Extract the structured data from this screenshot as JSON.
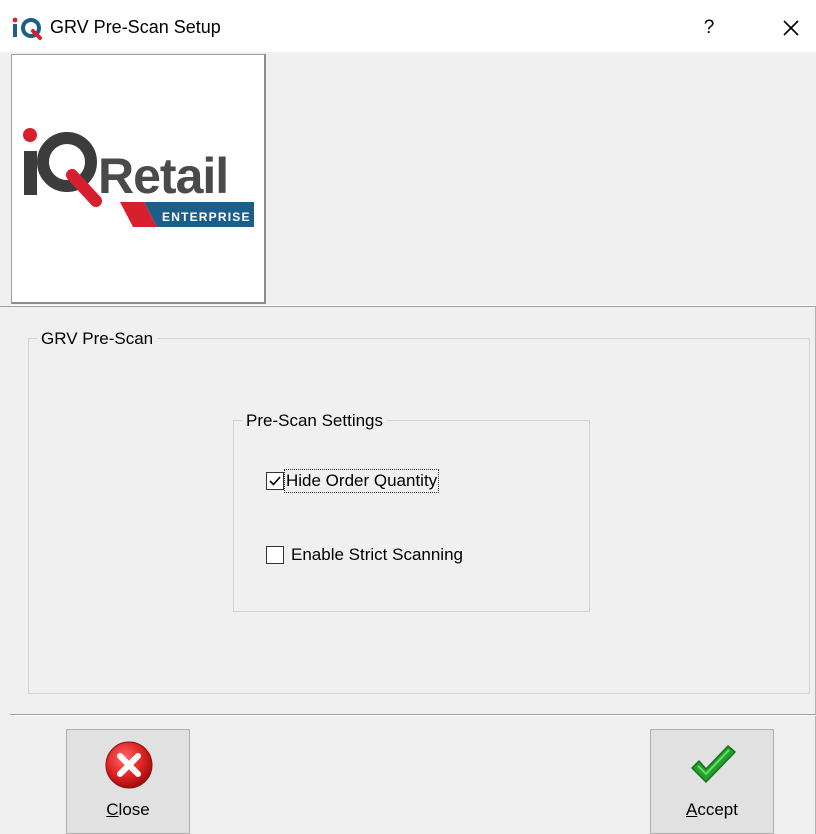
{
  "window": {
    "app_icon": "iq-logo-icon",
    "title": "GRV Pre-Scan Setup",
    "help_label": "?",
    "close_icon": "close-icon"
  },
  "logo": {
    "brand_text": "iQRetail",
    "sub_text": "ENTERPRISE",
    "colors": {
      "red": "#d71f2e",
      "dark": "#3c3c3c",
      "blue": "#1a5f8c"
    }
  },
  "group_main": {
    "label": "GRV Pre-Scan"
  },
  "group_settings": {
    "label": "Pre-Scan Settings",
    "options": [
      {
        "label": "Hide Order Quantity",
        "checked": true
      },
      {
        "label": "Enable Strict Scanning",
        "checked": false
      }
    ]
  },
  "footer": {
    "close": {
      "accel": "C",
      "rest": "lose",
      "icon": "cancel-red-x-icon",
      "color": "#e02424"
    },
    "accept": {
      "accel": "A",
      "rest": "ccept",
      "icon": "green-checkmark-icon",
      "color": "#22a22a"
    }
  }
}
